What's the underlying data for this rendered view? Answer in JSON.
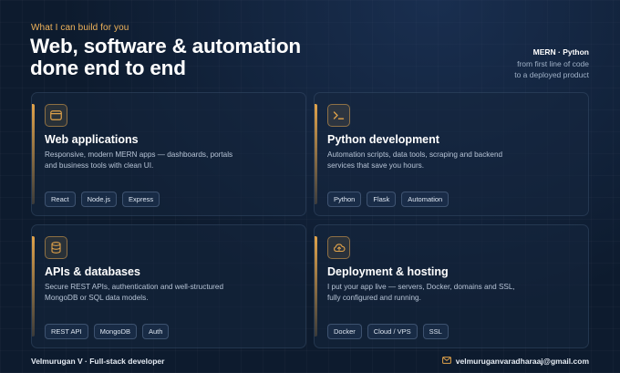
{
  "header": {
    "eyebrow": "What I can build for you",
    "title_line1": "Web, software & automation",
    "title_line2": "done end to end",
    "aside_tech": "MERN · Python",
    "aside_line1": "from first line of code",
    "aside_line2": "to a deployed product"
  },
  "cards": [
    {
      "icon": "browser-window-icon",
      "title": "Web applications",
      "desc_line1": "Responsive, modern MERN apps — dashboards, portals",
      "desc_line2": "and business tools with clean UI.",
      "tags": [
        "React",
        "Node.js",
        "Express"
      ]
    },
    {
      "icon": "terminal-prompt-icon",
      "title": "Python development",
      "desc_line1": "Automation scripts, data tools, scraping and backend",
      "desc_line2": "services that save you hours.",
      "tags": [
        "Python",
        "Flask",
        "Automation"
      ]
    },
    {
      "icon": "database-icon",
      "title": "APIs & databases",
      "desc_line1": "Secure REST APIs, authentication and well-structured",
      "desc_line2": "MongoDB or SQL data models.",
      "tags": [
        "REST API",
        "MongoDB",
        "Auth"
      ]
    },
    {
      "icon": "cloud-upload-icon",
      "title": "Deployment & hosting",
      "desc_line1": "I put your app live — servers, Docker, domains and SSL,",
      "desc_line2": "fully configured and running.",
      "tags": [
        "Docker",
        "Cloud / VPS",
        "SSL"
      ]
    }
  ],
  "footer": {
    "name": "Velmurugan V · Full-stack developer",
    "email_icon": "mail-icon",
    "email": "velmuruganvaradharaaj@gmail.com"
  },
  "colors": {
    "accent": "#e0a24a",
    "background": "#0d1b2e"
  }
}
